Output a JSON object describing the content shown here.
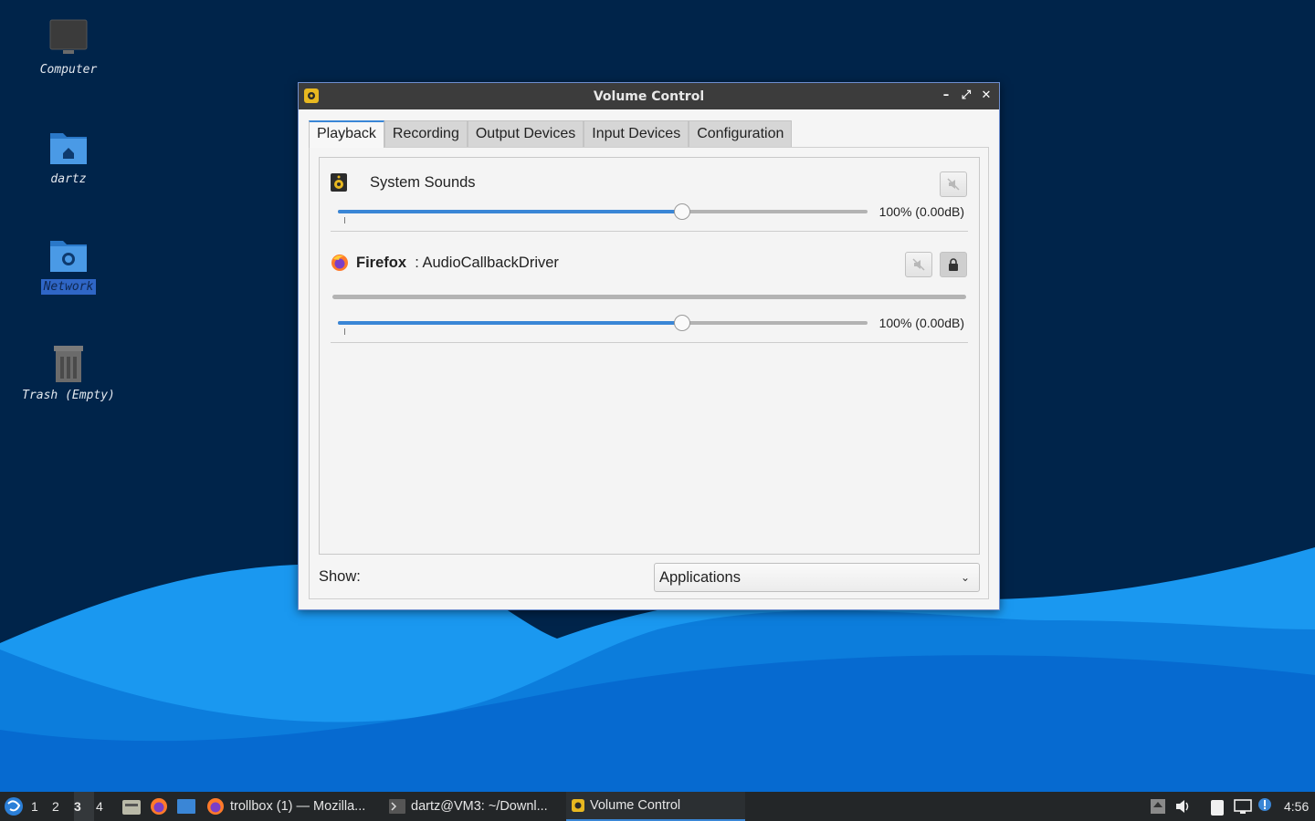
{
  "desktop": {
    "icons": [
      {
        "label": "Computer"
      },
      {
        "label": "dartz"
      },
      {
        "label": "Network"
      },
      {
        "label": "Trash (Empty)"
      }
    ]
  },
  "window": {
    "title": "Volume Control",
    "controls": {
      "minimize": "–",
      "maximize": "⤢",
      "close": "✕"
    },
    "tabs": [
      {
        "label": "Playback",
        "active": true
      },
      {
        "label": "Recording"
      },
      {
        "label": "Output Devices"
      },
      {
        "label": "Input Devices"
      },
      {
        "label": "Configuration"
      }
    ],
    "streams": [
      {
        "name": "System Sounds",
        "app": "",
        "volume_text": "100% (0.00dB)",
        "volume_fraction": 0.65
      },
      {
        "name": ": AudioCallbackDriver",
        "app": "Firefox",
        "volume_text": "100% (0.00dB)",
        "volume_fraction": 0.65
      }
    ],
    "show": {
      "label": "Show:",
      "selected": "Applications"
    }
  },
  "taskbar": {
    "workspaces": [
      "1",
      "2",
      "3",
      "4"
    ],
    "active_workspace": "3",
    "tasks": [
      {
        "label": "trollbox (1) — Mozilla..."
      },
      {
        "label": "dartz@VM3: ~/Downl..."
      },
      {
        "label": "Volume Control",
        "active": true
      }
    ],
    "clock": "4:56"
  },
  "colors": {
    "accent": "#3a86d6",
    "wallpaper_bg": "#00244a",
    "wave_light": "#1a98f0",
    "wave_mid": "#0a72d8"
  }
}
